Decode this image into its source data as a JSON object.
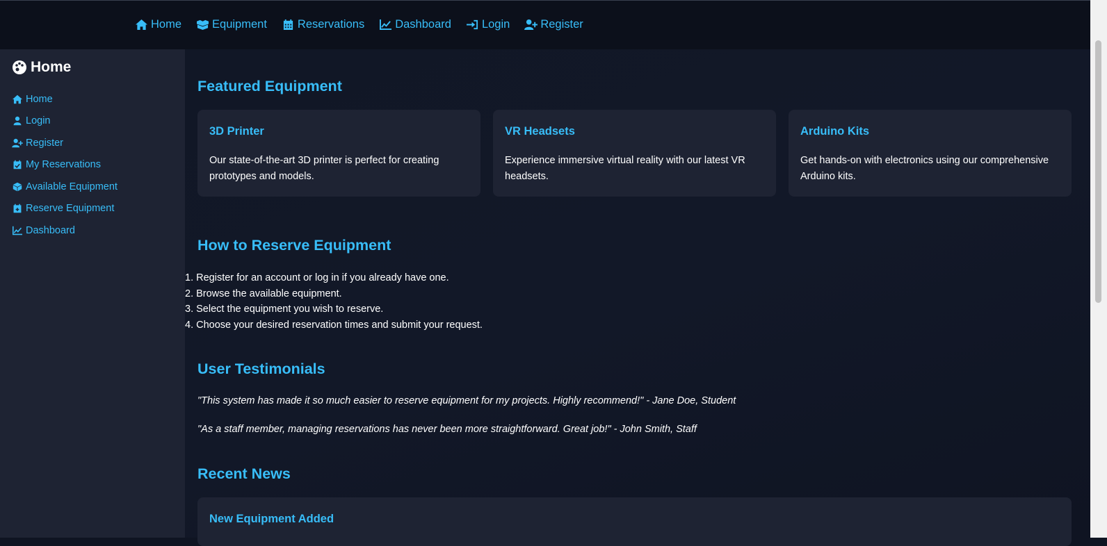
{
  "topnav": {
    "items": [
      {
        "label": "Home",
        "icon": "home-icon"
      },
      {
        "label": "Equipment",
        "icon": "boxes-icon"
      },
      {
        "label": "Reservations",
        "icon": "calendar-icon"
      },
      {
        "label": "Dashboard",
        "icon": "chart-line-icon"
      },
      {
        "label": "Login",
        "icon": "sign-in-icon"
      },
      {
        "label": "Register",
        "icon": "user-plus-icon"
      }
    ]
  },
  "sidebar": {
    "title": "Home",
    "title_icon": "palette-icon",
    "items": [
      {
        "label": "Home",
        "icon": "home-icon"
      },
      {
        "label": "Login",
        "icon": "user-icon"
      },
      {
        "label": "Register",
        "icon": "user-plus-icon"
      },
      {
        "label": "My Reservations",
        "icon": "calendar-check-icon"
      },
      {
        "label": "Available Equipment",
        "icon": "box-icon"
      },
      {
        "label": "Reserve Equipment",
        "icon": "calendar-plus-icon"
      },
      {
        "label": "Dashboard",
        "icon": "chart-line-icon"
      }
    ]
  },
  "featured": {
    "heading": "Featured Equipment",
    "cards": [
      {
        "title": "3D Printer",
        "text": "Our state-of-the-art 3D printer is perfect for creating prototypes and models."
      },
      {
        "title": "VR Headsets",
        "text": "Experience immersive virtual reality with our latest VR headsets."
      },
      {
        "title": "Arduino Kits",
        "text": "Get hands-on with electronics using our comprehensive Arduino kits."
      }
    ]
  },
  "howto": {
    "heading": "How to Reserve Equipment",
    "steps": [
      "1. Register for an account or log in if you already have one.",
      "2. Browse the available equipment.",
      "3. Select the equipment you wish to reserve.",
      "4. Choose your desired reservation times and submit your request."
    ]
  },
  "testimonials": {
    "heading": "User Testimonials",
    "quotes": [
      "\"This system has made it so much easier to reserve equipment for my projects. Highly recommend!\" - Jane Doe, Student",
      "\"As a staff member, managing reservations has never been more straightforward. Great job!\" - John Smith, Staff"
    ]
  },
  "news": {
    "heading": "Recent News",
    "items": [
      {
        "title": "New Equipment Added"
      }
    ]
  },
  "colors": {
    "accent": "#38bdf8",
    "background": "#0f1422",
    "panel": "#1e2333",
    "header": "#0c101b"
  }
}
